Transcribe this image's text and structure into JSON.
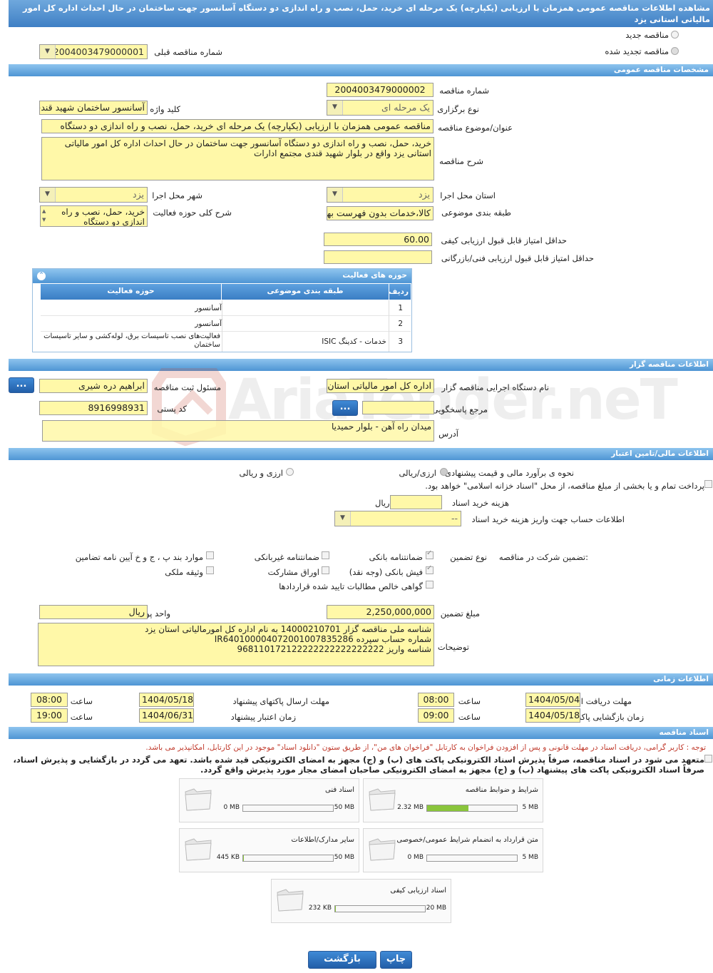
{
  "title": "مشاهده اطلاعات مناقصه عمومی همزمان با ارزیابی (یکپارچه) یک مرحله ای خرید، حمل، نصب و راه اندازی دو دستگاه آسانسور جهت ساختمان در حال احداث اداره کل امور مالیاتی استانی یزد",
  "top": {
    "new_tender": "مناقصه جدید",
    "renewed_tender": "مناقصه تجدید شده",
    "prev_number_label": "شماره مناقصه قبلی",
    "prev_number_value": "2004003479000001"
  },
  "general": {
    "section": "مشخصات مناقصه عمومی",
    "number_label": "شماره مناقصه",
    "number_value": "2004003479000002",
    "type_label": "نوع برگزاری",
    "type_value": "یک مرحله ای",
    "keyword_label": "کلید واژه",
    "keyword_value": "آسانسور ساختمان شهید قندی",
    "subject_label": "عنوان/موضوع مناقصه",
    "subject_value": "مناقصه عمومی همزمان با ارزیابی (یکپارچه) یک مرحله ای خرید، حمل، نصب و راه اندازی دو دستگاه",
    "desc_label": "شرح مناقصه",
    "desc_value": "خرید، حمل، نصب و راه اندازی دو دستگاه آسانسور جهت ساختمان در حال احداث اداره کل امور مالیاتی استانی یزد واقع در بلوار شهید قندی مجتمع ادارات",
    "province_label": "استان محل اجرا",
    "province_value": "یزد",
    "city_label": "شهر محل اجرا",
    "city_value": "یزد",
    "category_label": "طبقه بندی موضوعی",
    "category_value": "کالا،خدمات بدون فهرست بها",
    "scope_label": "شرح کلی حوزه فعالیت",
    "scope_value": "خرید، حمل، نصب و راه اندازی دو دستگاه آسانسور",
    "min_quality_label": "حداقل امتیاز قابل قبول ارزیابی کیفی",
    "min_quality_value": "60.00",
    "min_tech_label": "حداقل امتیاز قابل قبول ارزیابی فنی/بازرگانی",
    "min_tech_value": ""
  },
  "activity": {
    "title": "حوزه های فعالیت",
    "headers": [
      "ردیف",
      "طبقه بندی موضوعی",
      "حوزه فعالیت"
    ],
    "rows": [
      {
        "n": "1",
        "cat": "",
        "field": "آسانسور"
      },
      {
        "n": "2",
        "cat": "",
        "field": "آسانسور"
      },
      {
        "n": "3",
        "cat": "خدمات - کدینگ ISIC",
        "field": "فعالیت‌های نصب تاسیسات برق، لوله‌کشی و سایر تاسیسات ساختمان"
      }
    ]
  },
  "organizer": {
    "section": "اطلاعات مناقصه گزار",
    "org_label": "نام دستگاه اجرایی مناقصه گزار",
    "org_value": "اداره کل امور مالیاتی استان یزد",
    "registrar_label": "مسئول ثبت مناقصه",
    "registrar_value": "ابراهیم دره شیری",
    "ref_label": "مرجع پاسخگویی",
    "ref_value": "",
    "postal_label": "کد پستی",
    "postal_value": "8916998931",
    "address_label": "آدرس",
    "address_value": "میدان راه آهن - بلوار حمیدیا",
    "more_btn": "..."
  },
  "finance": {
    "section": "اطلاعات مالی/تامین اعتبار",
    "estimate_label": "نحوه ی برآورد مالی و قیمت پیشنهادی",
    "opt_rial": "ارزی/ریالی",
    "opt_fx": "ارزی و ریالی",
    "islamic_text": "پرداخت تمام و یا بخشی از مبلغ مناقصه، از محل \"اسناد خزانه اسلامی\" خواهد بود.",
    "doc_cost_label": "هزینه خرید اسناد",
    "doc_cost_unit": "ریال",
    "doc_cost_value": "",
    "account_label": "اطلاعات حساب جهت واریز هزینه خرید اسناد",
    "account_value": "--"
  },
  "guarantee": {
    "label": "تضمین شرکت در مناقصه:",
    "type_label": "نوع تضمین",
    "items": [
      "ضمانتنامه بانکی",
      "ضمانتنامه غیربانکی",
      "موارد بند پ ، ج و خ آیین نامه تضامین",
      "فیش بانکی (وجه نقد)",
      "اوراق مشارکت",
      "وثیقه ملکی",
      "گواهی خالص مطالبات تایید شده قراردادها"
    ],
    "amount_label": "مبلغ تضمین",
    "amount_value": "2,250,000,000",
    "currency_label": "واحد پول",
    "currency_value": "ریال",
    "notes_label": "توضیحات",
    "notes_value": "شناسه ملی مناقصه گزار 14000210701 به نام اداره کل امورمالیاتی استان یزد\nشماره حساب سپرده IR640100004072001007835286\nشناسه واریز 968110172122222222222222222"
  },
  "timing": {
    "section": "اطلاعات زمانی",
    "receive_label": "مهلت دریافت اسناد",
    "receive_date": "1404/05/04",
    "receive_time": "08:00",
    "send_label": "مهلت ارسال پاکتهای پیشنهاد",
    "send_date": "1404/05/18",
    "send_time": "08:00",
    "open_label": "زمان بازگشایی پاکت ها",
    "open_date": "1404/05/18",
    "open_time": "09:00",
    "valid_label": "زمان اعتبار پیشنهاد",
    "valid_date": "1404/06/31",
    "valid_time": "19:00",
    "time_label": "ساعت"
  },
  "docs": {
    "section": "اسناد مناقصه",
    "note": "توجه : کاربر گرامی، دریافت اسناد در مهلت قانونی و پس از افزودن فراخوان به کارتابل \"فراخوان های من\"، از طریق ستون \"دانلود اسناد\" موجود در این کارتابل، امکانپذیر می باشد.",
    "commit": "متعهد می شود در اسناد مناقصه، صرفاً پذیرش اسناد الکترونیکی پاکت های (ب) و (ج) مجهز به امضای الکترونیکی قید شده باشد. تعهد می گردد در بازگشایی و پذیرش اسناد، صرفاً اسناد الکترونیکی پاکت های پیشنهاد (ب) و (ج) مجهز به امضای الکترونیکی صاحبان امضای مجاز مورد پذیرش واقع گردد.",
    "files": [
      {
        "name": "شرایط و ضوابط مناقصه",
        "size": "2.32 MB",
        "max": "5 MB",
        "fill": 0.46
      },
      {
        "name": "اسناد فنی",
        "size": "0 MB",
        "max": "50 MB",
        "fill": 0
      },
      {
        "name": "متن قرارداد به انضمام شرایط عمومی/خصوصی",
        "size": "0 MB",
        "max": "5 MB",
        "fill": 0
      },
      {
        "name": "سایر مدارک/اطلاعات",
        "size": "445 KB",
        "max": "50 MB",
        "fill": 0.01
      },
      {
        "name": "اسناد ارزیابی کیفی",
        "size": "232 KB",
        "max": "20 MB",
        "fill": 0.01
      }
    ]
  },
  "buttons": {
    "print": "چاپ",
    "back": "بازگشت"
  },
  "watermark": "AriaTender.neT"
}
